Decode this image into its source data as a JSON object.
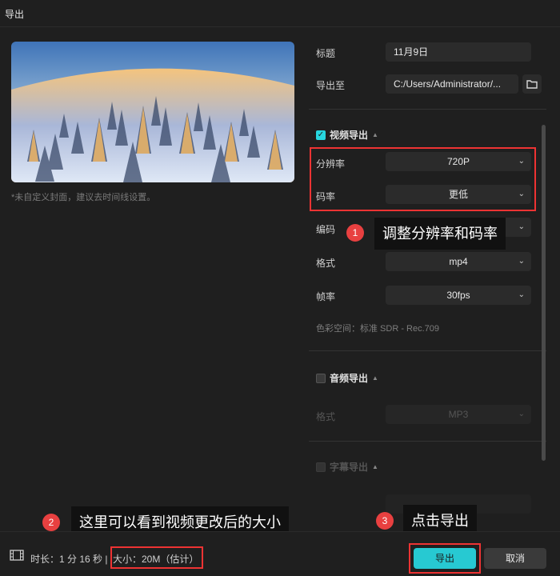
{
  "window": {
    "title": "导出"
  },
  "cover": {
    "note": "*未自定义封面，建议去时间线设置。"
  },
  "form": {
    "title_label": "标题",
    "title_value": "11月9日",
    "export_to_label": "导出至",
    "export_path": "C:/Users/Administrator/...",
    "folder_icon": "folder-icon"
  },
  "video": {
    "section_label": "视频导出",
    "checked": true,
    "resolution_label": "分辨率",
    "resolution_value": "720P",
    "bitrate_label": "码率",
    "bitrate_value": "更低",
    "codec_label": "编码",
    "format_label": "格式",
    "format_value": "mp4",
    "fps_label": "帧率",
    "fps_value": "30fps",
    "colorspace": "色彩空间：标准 SDR - Rec.709"
  },
  "audio": {
    "section_label": "音频导出",
    "checked": false,
    "format_label": "格式",
    "format_value": "MP3"
  },
  "subtitle": {
    "section_label": "字幕导出"
  },
  "annotations": [
    {
      "number": "1",
      "text": "调整分辨率和码率"
    },
    {
      "number": "2",
      "text": "这里可以看到视频更改后的大小"
    },
    {
      "number": "3",
      "text": "点击导出"
    }
  ],
  "footer": {
    "duration": "时长：1 分 16 秒 |",
    "size": "大小：20M（估计）",
    "export_button": "导出",
    "cancel_button": "取消"
  },
  "colors": {
    "accent": "#27c9d2",
    "annotation_red": "#e84040",
    "background": "#1f1f1f",
    "field": "#2b2b2b"
  }
}
